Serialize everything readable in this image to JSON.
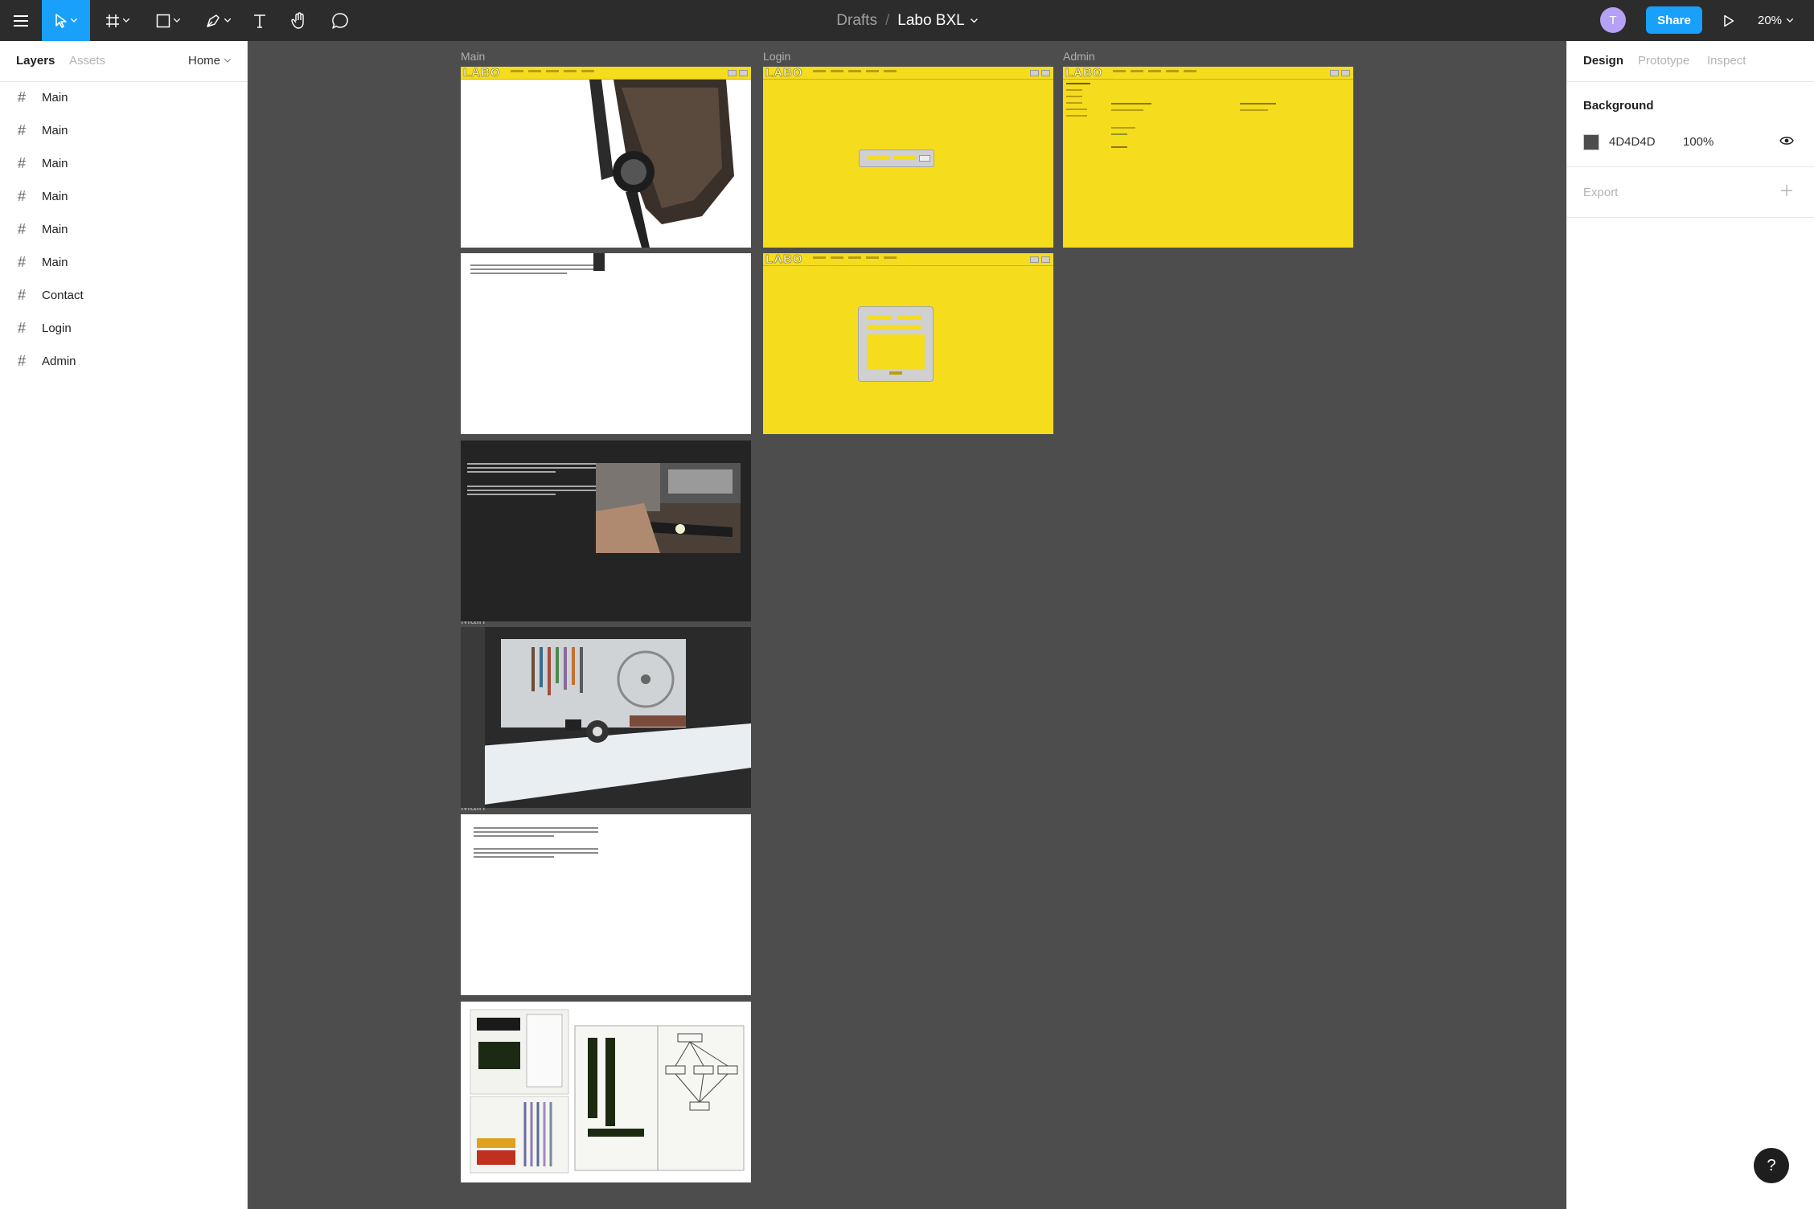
{
  "toolbar": {
    "breadcrumb_root": "Drafts",
    "breadcrumb_sep": "/",
    "file_name": "Labo BXL",
    "avatar_initial": "T",
    "share_label": "Share",
    "zoom_label": "20%",
    "accent_color": "#18a0fb"
  },
  "left_panel": {
    "tab_layers": "Layers",
    "tab_assets": "Assets",
    "page_selector": "Home",
    "layers": [
      {
        "label": "Main"
      },
      {
        "label": "Main"
      },
      {
        "label": "Main"
      },
      {
        "label": "Main"
      },
      {
        "label": "Main"
      },
      {
        "label": "Main"
      },
      {
        "label": "Contact"
      },
      {
        "label": "Login"
      },
      {
        "label": "Admin"
      }
    ]
  },
  "right_panel": {
    "tab_design": "Design",
    "tab_prototype": "Prototype",
    "tab_inspect": "Inspect",
    "background_title": "Background",
    "background_hex": "4D4D4D",
    "background_color": "#4d4d4d",
    "background_opacity": "100%",
    "export_title": "Export"
  },
  "canvas": {
    "frame_labels": {
      "main_1": "Main",
      "login": "Login",
      "admin": "Admin",
      "main_4": "Main",
      "main_5": "Main"
    },
    "mini_logo": "LABO",
    "frame_colors": {
      "yellow": "#f5dc1d",
      "dark": "#242424",
      "white": "#ffffff"
    }
  },
  "help_label": "?"
}
